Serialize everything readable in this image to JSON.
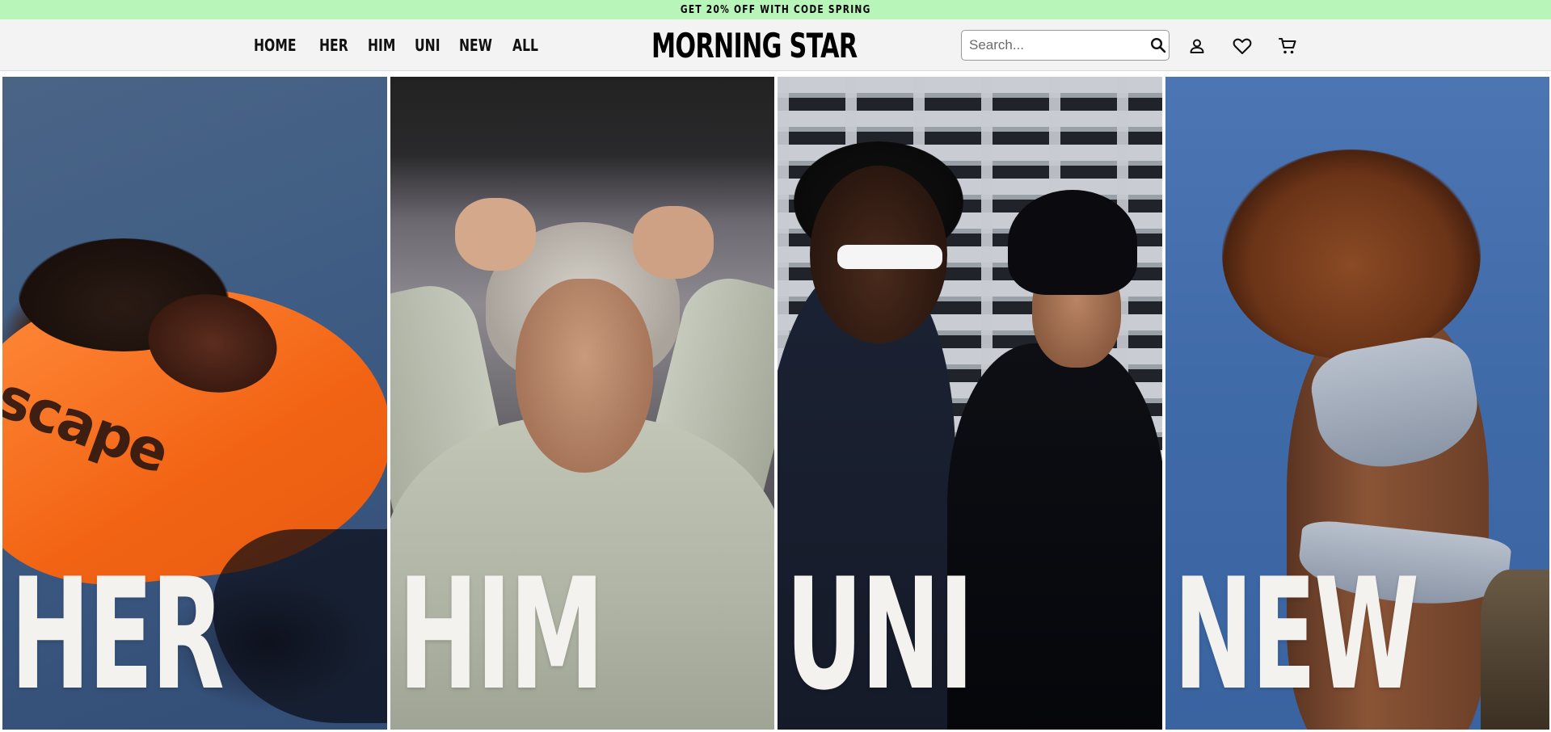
{
  "promo": {
    "prefix": "GET 20% OFF WITH CODE",
    "code": "SPRING",
    "bg_color": "#b8f5b8"
  },
  "nav": {
    "items": [
      {
        "label": "HOME"
      },
      {
        "label": "HER"
      },
      {
        "label": "HIM"
      },
      {
        "label": "UNI"
      },
      {
        "label": "NEW"
      },
      {
        "label": "ALL"
      }
    ]
  },
  "brand": {
    "name": "MORNING STAR"
  },
  "search": {
    "placeholder": "Search..."
  },
  "header_icons": [
    "user-icon",
    "heart-icon",
    "cart-icon"
  ],
  "categories": [
    {
      "label": "HER"
    },
    {
      "label": "HIM"
    },
    {
      "label": "UNI"
    },
    {
      "label": "NEW"
    }
  ],
  "her_card_print": "scape"
}
